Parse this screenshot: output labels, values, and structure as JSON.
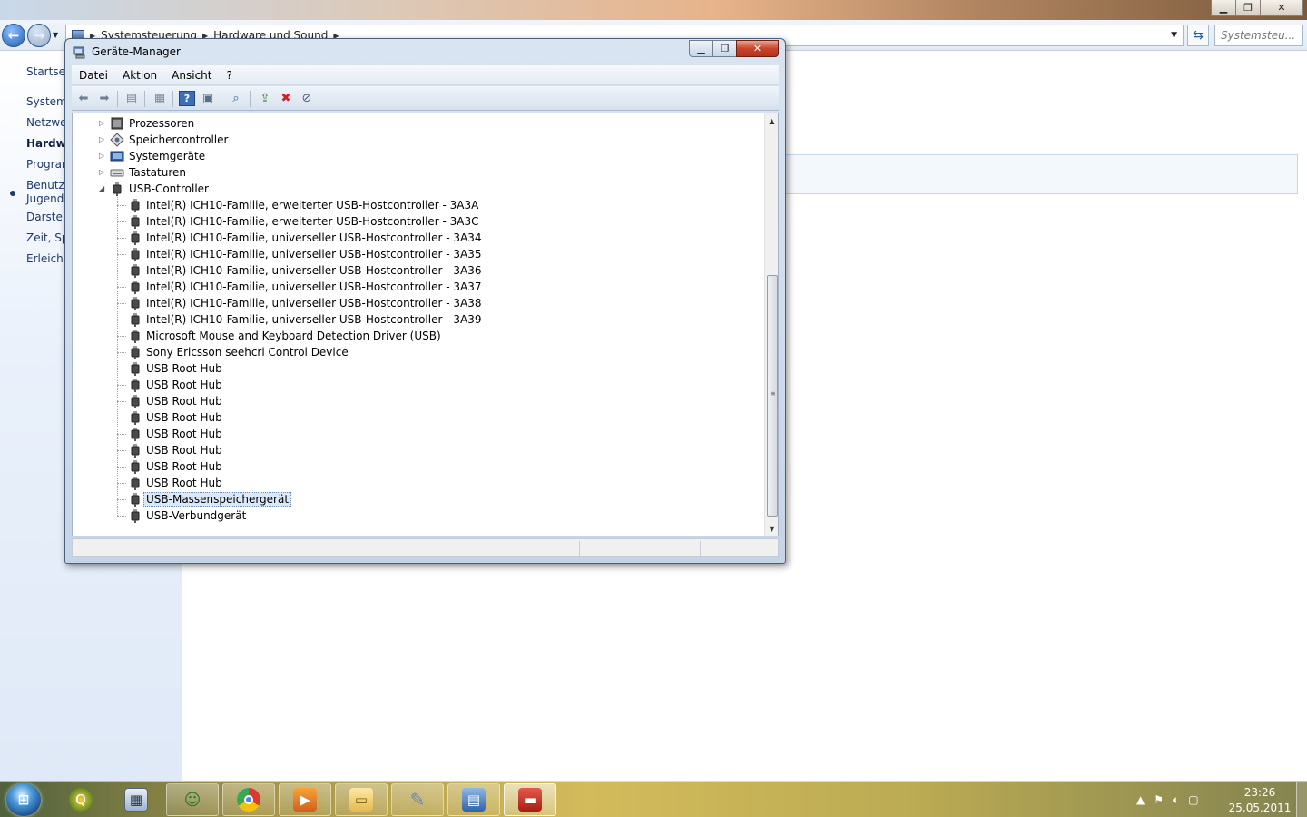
{
  "control_panel": {
    "breadcrumb": [
      "Systemsteuerung",
      "Hardware und Sound"
    ],
    "search_placeholder": "Systemsteu...",
    "sidebar": [
      "Startseite",
      "System",
      "Netzwer",
      "Hardwa",
      "Program",
      "Benutze",
      "Jugends",
      "Darstell",
      "Zeit, Spr",
      "Erleicht"
    ],
    "active_sidebar_index": 3
  },
  "device_manager": {
    "title": "Geräte-Manager",
    "menu": [
      "Datei",
      "Aktion",
      "Ansicht",
      "?"
    ],
    "categories": [
      {
        "label": "Prozessoren",
        "icon": "processor-icon"
      },
      {
        "label": "Speichercontroller",
        "icon": "storage-controller-icon"
      },
      {
        "label": "Systemgeräte",
        "icon": "system-device-icon"
      },
      {
        "label": "Tastaturen",
        "icon": "keyboard-icon"
      }
    ],
    "expanded_category": "USB-Controller",
    "usb_devices": [
      "Intel(R) ICH10-Familie, erweiterter USB-Hostcontroller - 3A3A",
      "Intel(R) ICH10-Familie, erweiterter USB-Hostcontroller - 3A3C",
      "Intel(R) ICH10-Familie, universeller USB-Hostcontroller - 3A34",
      "Intel(R) ICH10-Familie, universeller USB-Hostcontroller - 3A35",
      "Intel(R) ICH10-Familie, universeller USB-Hostcontroller - 3A36",
      "Intel(R) ICH10-Familie, universeller USB-Hostcontroller - 3A37",
      "Intel(R) ICH10-Familie, universeller USB-Hostcontroller - 3A38",
      "Intel(R) ICH10-Familie, universeller USB-Hostcontroller - 3A39",
      "Microsoft Mouse and Keyboard Detection Driver (USB)",
      "Sony Ericsson seehcri Control Device",
      "USB Root Hub",
      "USB Root Hub",
      "USB Root Hub",
      "USB Root Hub",
      "USB Root Hub",
      "USB Root Hub",
      "USB Root Hub",
      "USB Root Hub",
      "USB-Massenspeichergerät",
      "USB-Verbundgerät"
    ],
    "selected_device_index": 18
  },
  "taskbar": {
    "time": "23:26",
    "date": "25.05.2011"
  }
}
